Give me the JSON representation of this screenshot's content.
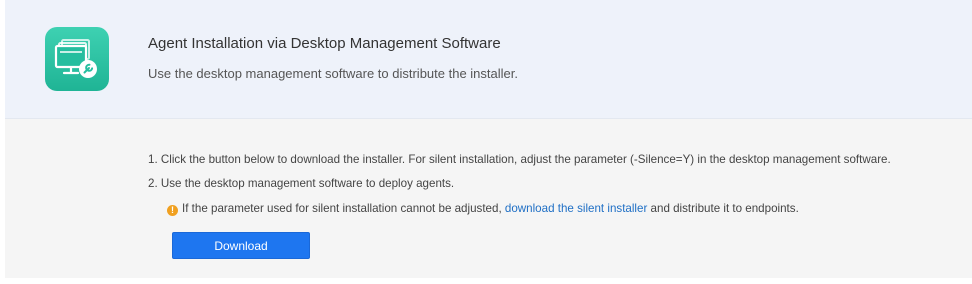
{
  "header": {
    "icon": "desktop-management-icon",
    "title": "Agent Installation via Desktop Management Software",
    "subtitle": "Use the desktop management software to distribute the installer."
  },
  "instructions": {
    "step1": "1. Click the button below to download the installer. For silent installation, adjust the parameter (-Silence=Y) in the desktop management software.",
    "step2": "2. Use the desktop management software to deploy agents.",
    "note_icon": "warning-icon",
    "note_prefix": "If the parameter used for silent installation cannot be adjusted, ",
    "note_link": "download the silent installer",
    "note_suffix": " and distribute it to endpoints."
  },
  "download_button": {
    "label": "Download"
  },
  "colors": {
    "header_bg": "#eef2fa",
    "body_bg": "#f5f5f5",
    "icon_bg": "#25be9f",
    "link": "#1f6fc5",
    "button": "#1e76f0",
    "warning": "#f0a020"
  }
}
